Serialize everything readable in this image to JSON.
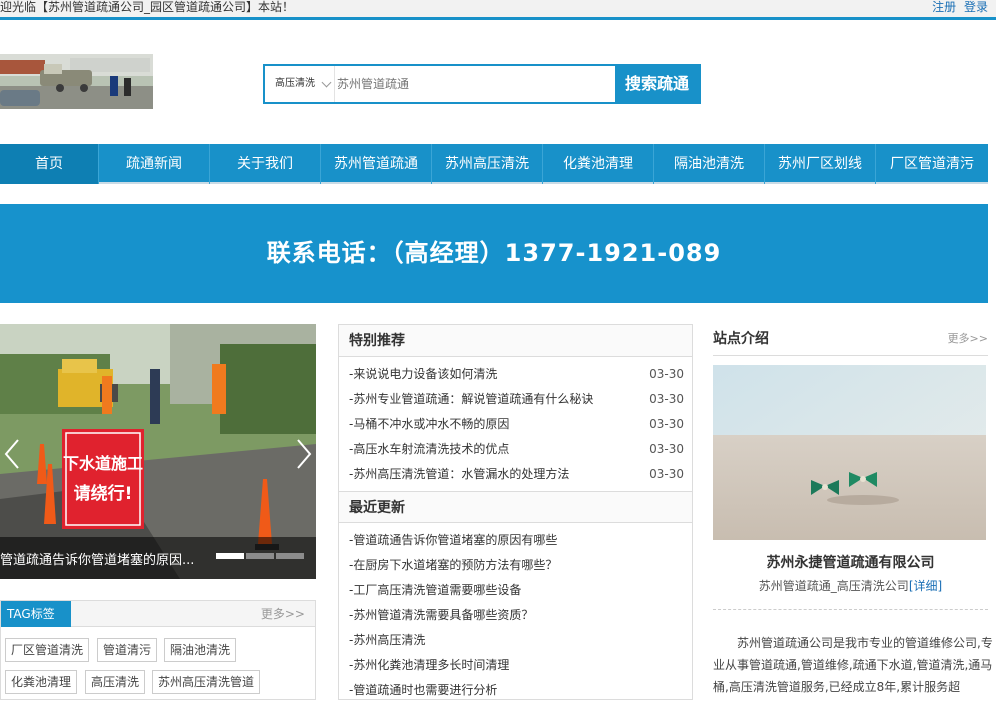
{
  "topbar": {
    "welcome": "迎光临【苏州管道疏通公司_园区管道疏通公司】本站！",
    "register": "注册",
    "login": "登录"
  },
  "search": {
    "type_selected": "高压清洗",
    "placeholder": "苏州管道疏通",
    "button": "搜索疏通"
  },
  "nav": {
    "items": [
      "首页",
      "疏通新闻",
      "关于我们",
      "苏州管道疏通",
      "苏州高压清洗",
      "化粪池清理",
      "隔油池清洗",
      "苏州厂区划线",
      "厂区管道清污"
    ]
  },
  "banner": {
    "phone": "联系电话：（高经理）1377-1921-089"
  },
  "slider": {
    "caption": "管道疏通告诉你管道堵塞的原因...",
    "slides_total": 3,
    "active_slide": 1,
    "sign_text": [
      "下水道施工",
      "请绕行!"
    ]
  },
  "tags": {
    "title": "TAG标签",
    "more": "更多>>",
    "items": [
      "厂区管道清洗",
      "管道清污",
      "隔油池清洗",
      "化粪池清理",
      "高压清洗",
      "苏州高压清洗管道"
    ]
  },
  "special": {
    "title": "特别推荐",
    "items": [
      {
        "title": "-来说说电力设备该如何清洗",
        "date": "03-30"
      },
      {
        "title": "-苏州专业管道疏通：解说管道疏通有什么秘诀",
        "date": "03-30"
      },
      {
        "title": "-马桶不冲水或冲水不畅的原因",
        "date": "03-30"
      },
      {
        "title": "-高压水车射流清洗技术的优点",
        "date": "03-30"
      },
      {
        "title": "-苏州高压清洗管道：水管漏水的处理方法",
        "date": "03-30"
      }
    ]
  },
  "recent": {
    "title": "最近更新",
    "items": [
      "-管道疏通告诉你管道堵塞的原因有哪些",
      "-在厨房下水道堵塞的预防方法有哪些？",
      "-工厂高压清洗管道需要哪些设备",
      "-苏州管道清洗需要具备哪些资质？",
      "-苏州高压清洗",
      "-苏州化粪池清理多长时间清理",
      "-管道疏通时也需要进行分析"
    ]
  },
  "intro": {
    "title": "站点介绍",
    "more": "更多>>",
    "company": "苏州永捷管道疏通有限公司",
    "subtitle": "苏州管道疏通_高压清洗公司",
    "detail_link": "[详细]",
    "description": "苏州管道疏通公司是我市专业的管道维修公司,专业从事管道疏通,管道维修,疏通下水道,管道清洗,通马桶,高压清洗管道服务,已经成立8年,累计服务超"
  },
  "colors": {
    "primary": "#1891c9",
    "link": "#1a6fb5"
  }
}
